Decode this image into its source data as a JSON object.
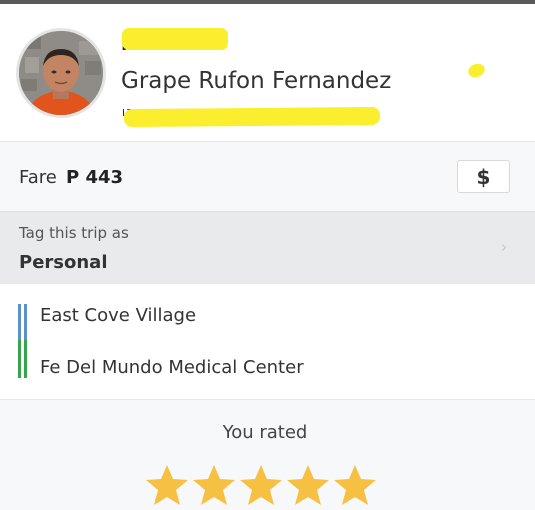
{
  "driver": {
    "name": "Grape Rufon Fernandez"
  },
  "fare": {
    "label": "Fare",
    "amount": "P 443",
    "payment_icon": "dollar-icon",
    "payment_symbol": "$"
  },
  "tag": {
    "label": "Tag this trip as",
    "value": "Personal",
    "chevron_icon": "chevron-right-icon"
  },
  "route": {
    "pickup": "East Cove Village",
    "dropoff": "Fe Del Mundo Medical Center",
    "pickup_color": "#5b90c8",
    "dropoff_color": "#37a34d"
  },
  "rating": {
    "label": "You rated",
    "stars": 5,
    "max_stars": 5,
    "star_color": "#f6c042",
    "star_icon": "star-icon"
  },
  "colors": {
    "redaction": "#fbee2f"
  }
}
